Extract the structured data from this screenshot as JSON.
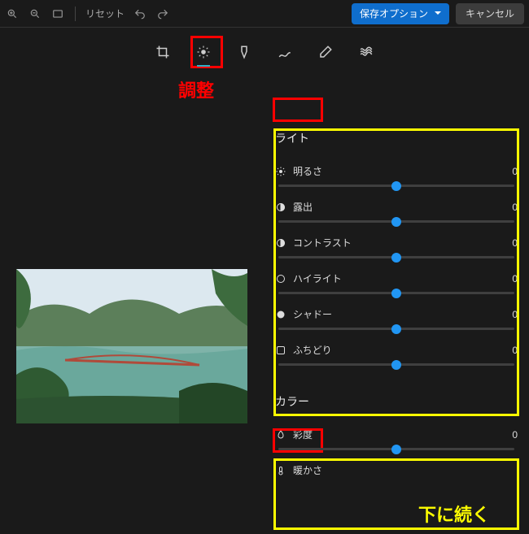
{
  "toolbar": {
    "reset_label": "リセット",
    "save_options_label": "保存オプション",
    "cancel_label": "キャンセル"
  },
  "tool_row": {
    "active_index": 1
  },
  "sections": {
    "light": {
      "title": "ライト",
      "sliders": [
        {
          "label": "明るさ",
          "value": "0"
        },
        {
          "label": "露出",
          "value": "0"
        },
        {
          "label": "コントラスト",
          "value": "0"
        },
        {
          "label": "ハイライト",
          "value": "0"
        },
        {
          "label": "シャドー",
          "value": "0"
        },
        {
          "label": "ふちどり",
          "value": "0"
        }
      ]
    },
    "color": {
      "title": "カラー",
      "sliders": [
        {
          "label": "彩度",
          "value": "0"
        },
        {
          "label": "暖かさ",
          "value": ""
        }
      ]
    }
  },
  "annotations": {
    "adjust_label": "調整",
    "continue_label": "下に続く"
  }
}
